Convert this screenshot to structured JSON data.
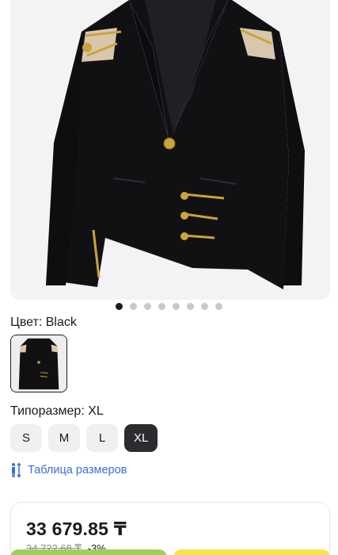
{
  "gallery": {
    "image_alt": "black blazer with gold safety pins",
    "dot_count": 8,
    "active_index": 0
  },
  "color": {
    "label": "Цвет: Black"
  },
  "size": {
    "label": "Типоразмер: XL",
    "options": [
      "S",
      "M",
      "L",
      "XL"
    ],
    "selected": "XL"
  },
  "size_table": {
    "label": "Таблица размеров",
    "icon": "people-size-icon"
  },
  "price": {
    "current": "33 679.85 ₸",
    "old": "34 722.68 ₸",
    "discount": "-3%"
  },
  "colors": {
    "selected_size_bg": "#2b2b30",
    "link": "#3b6fd6",
    "green_button": "#9bd255",
    "yellow_button": "#f6e44a"
  }
}
